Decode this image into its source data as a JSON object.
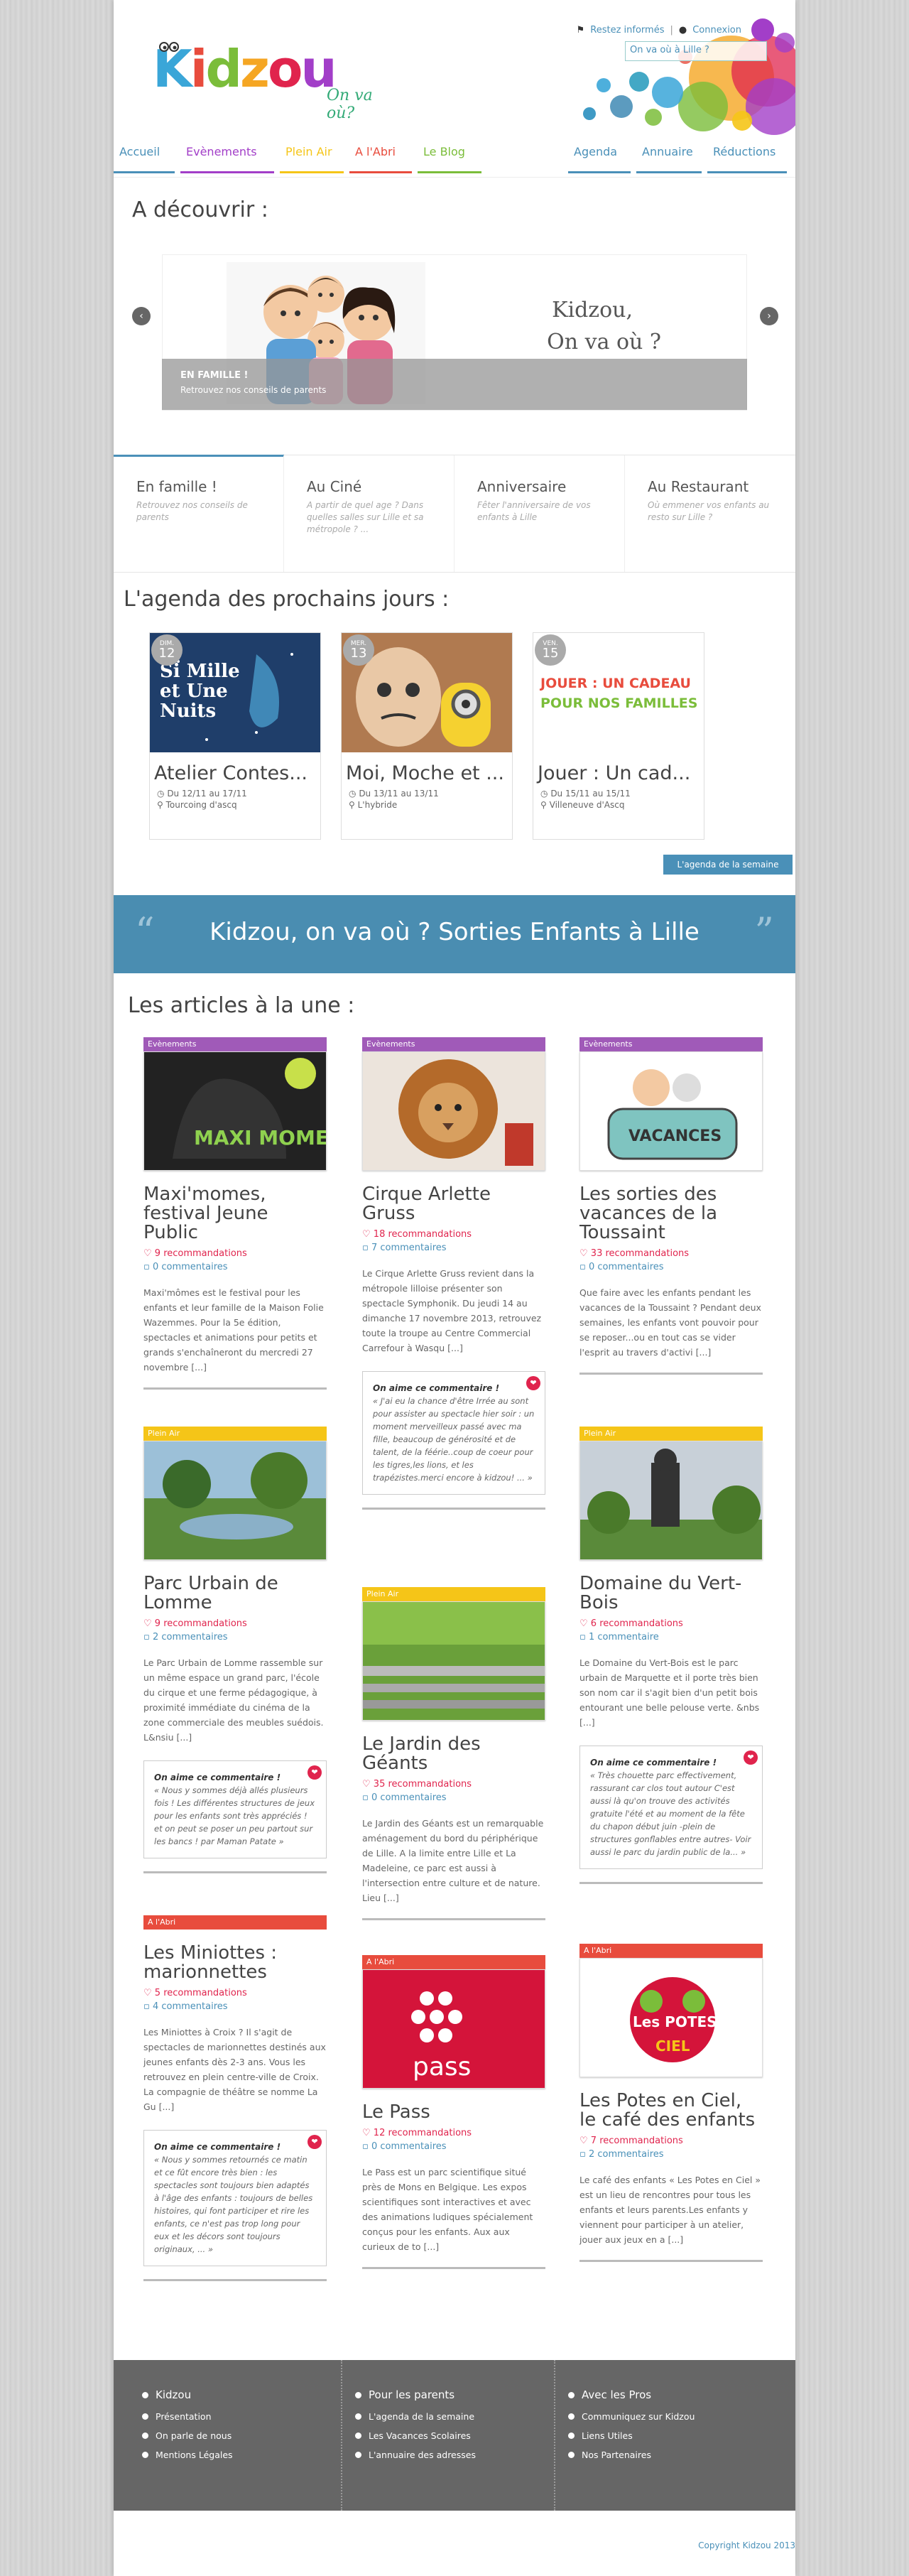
{
  "top": {
    "stay_informed": "Restez informés",
    "login": "Connexion",
    "search_placeholder": "On va où à Lille ?"
  },
  "logo": {
    "word": "Kidzou",
    "tagline": "On va où?"
  },
  "nav": {
    "left": [
      {
        "label": "Accueil",
        "color": "#4a90b8"
      },
      {
        "label": "Evènements",
        "color": "#a23ec8"
      },
      {
        "label": "Plein Air",
        "color": "#f5c518"
      },
      {
        "label": "A l'Abri",
        "color": "#e84c3d"
      },
      {
        "label": "Le Blog",
        "color": "#7bbd3a"
      }
    ],
    "right": [
      "Agenda",
      "Annuaire",
      "Réductions"
    ]
  },
  "discover": {
    "title": "A découvrir :",
    "slide_title_1": "Kidzou,",
    "slide_title_2": "On va où ?",
    "caption_title": "EN FAMILLE !",
    "caption_text": "Retrouvez nos conseils de parents"
  },
  "tabs": [
    {
      "title": "En famille !",
      "text": "Retrouvez nos conseils de parents"
    },
    {
      "title": "Au Ciné",
      "text": "A partir de quel age ? Dans quelles salles sur Lille et sa métropole ? ..."
    },
    {
      "title": "Anniversaire",
      "text": "Fêter l'anniversaire de vos enfants à Lille"
    },
    {
      "title": "Au Restaurant",
      "text": "Où emmener vos enfants au resto sur Lille ?"
    }
  ],
  "agenda": {
    "title": "L'agenda des prochains jours :",
    "cards": [
      {
        "day": "DIM.",
        "num": "12",
        "title": "Atelier Contes...",
        "dates": "Du 12/11 au 17/11",
        "place": "Tourcoing d'ascq"
      },
      {
        "day": "MER.",
        "num": "13",
        "title": "Moi, Moche et ...",
        "dates": "Du 13/11 au 13/11",
        "place": "L'hybride"
      },
      {
        "day": "VEN.",
        "num": "15",
        "title": "Jouer : Un cad...",
        "dates": "Du 15/11 au 15/11",
        "place": "Villeneuve d'Ascq"
      }
    ],
    "week_button": "L'agenda de la semaine",
    "card1_img_text": "Si Mille et Une Nuits",
    "card3_img_text_1": "JOUER : UN CADEAU",
    "card3_img_text_2": "POUR NOS FAMILLES"
  },
  "banner": {
    "text": "Kidzou, on va où ? Sorties Enfants à Lille"
  },
  "articles": {
    "title": "Les articles à la une :",
    "quote_header": "On aime ce commentaire !",
    "items": [
      {
        "cat": "Evènements",
        "title": "Maxi'momes, festival Jeune Public",
        "rec": "9  recommandations",
        "com": "0 commentaires",
        "desc": "Maxi'mômes est le festival pour les enfants et leur famille de la Maison Folie Wazemmes. Pour la 5e édition, spectacles et animations pour petits et grands s'enchaîneront du mercredi 27 novembre [...]",
        "quote": "",
        "pic_text": "MAXI MOMES"
      },
      {
        "cat": "Evènements",
        "title": "Cirque Arlette Gruss",
        "rec": "18  recommandations",
        "com": "7 commentaires",
        "desc": "Le Cirque Arlette Gruss revient dans la métropole lilloise présenter son spectacle Symphonik. Du jeudi 14 au dimanche 17 novembre 2013, retrouvez toute la troupe au Centre Commercial Carrefour à Wasqu [...]",
        "quote": "« J'ai eu la chance d'être Irrée au sont pour assister au spectacle hier soir : un moment merveilleux passé avec ma fille, beaucoup de générosité et de talent, de la féérie..coup de coeur pour les tigres,les lions, et les trapézistes.merci encore à kidzou! ... »"
      },
      {
        "cat": "Evènements",
        "title": "Les sorties des vacances de la Toussaint",
        "rec": "33  recommandations",
        "com": "0 commentaires",
        "desc": "Que faire avec les enfants pendant les vacances de la Toussaint ? Pendant deux semaines, les enfants vont pouvoir pour se reposer...ou en tout cas se vider l'esprit au travers d'activi [...]",
        "quote": "",
        "pic_text": "VACANCES"
      },
      {
        "cat": "Plein Air",
        "title": "Parc Urbain de Lomme",
        "rec": "9  recommandations",
        "com": "2 commentaires",
        "desc": "Le Parc Urbain de Lomme rassemble sur un même espace un grand parc, l'école du cirque et une ferme pédagogique, à proximité immédiate du cinéma de la zone commerciale des meubles suédois. L&nsiu [...]",
        "quote": "« Nous y sommes déjà allés plusieurs fois ! Les différentes structures de jeux pour les enfants sont très appréciés ! et on peut se poser un peu partout sur les bancs ! par Maman Patate »"
      },
      {
        "cat": "Plein Air",
        "title": "Le Jardin des Géants",
        "rec": "35  recommandations",
        "com": "0 commentaires",
        "desc": "Le Jardin des Géants est un remarquable aménagement du bord du périphérique de Lille. A la limite entre Lille et La Madeleine, ce parc est aussi à l'intersection entre culture et de nature. Lieu [...]",
        "quote": ""
      },
      {
        "cat": "Plein Air",
        "title": "Domaine du Vert-Bois",
        "rec": "6  recommandations",
        "com": "1 commentaire",
        "desc": "Le Domaine du Vert-Bois est le parc urbain de Marquette et il porte très bien son nom car il s'agit bien d'un petit bois entourant une belle pelouse verte.     &nbs [...]",
        "quote": "« Très chouette parc effectivement, rassurant car clos tout autour C'est aussi là qu'on trouve des activités gratuite l'été et au moment de la fête du chapon début juin -plein de structures gonflables entre autres- Voir aussi le parc du jardin public de la... »"
      },
      {
        "cat": "A l'Abri",
        "title": "Les Miniottes : marionnettes",
        "rec": "5  recommandations",
        "com": "4 commentaires",
        "desc": "Les Miniottes à Croix ? Il s'agit de spectacles de marionnettes destinés aux jeunes enfants dès 2-3 ans. Vous les retrouvez en plein centre-ville de Croix. La compagnie de théâtre se nomme La Gu [...]",
        "quote": "« Nous y sommes retournés ce matin et ce fût encore très bien : les spectacles sont toujours bien adaptés à l'âge des enfants : toujours de belles histoires, qui font participer et rire les enfants, ce n'est pas trop long pour eux et les décors sont toujours originaux, ... »"
      },
      {
        "cat": "A l'Abri",
        "title": "Le Pass",
        "rec": "12  recommandations",
        "com": "0 commentaires",
        "desc": "Le Pass est un parc scientifique situé près de Mons en Belgique. Les expos scientifiques sont interactives et avec des animations ludiques spécialement conçus pour les enfants. Aux aux curieux de to [...]",
        "quote": "",
        "pic_text": "pass"
      },
      {
        "cat": "A l'Abri",
        "title": "Les Potes en Ciel, le café des enfants",
        "rec": "7  recommandations",
        "com": "2 commentaires",
        "desc": "Le café des enfants « Les Potes en Ciel » est un lieu de rencontres pour tous les enfants et leurs parents.Les enfants y viennent pour participer à un atelier, jouer aux jeux en a [...]",
        "quote": "",
        "pic_text_1": "Les POTES",
        "pic_text_2": "CIEL"
      }
    ]
  },
  "footer": {
    "cols": [
      {
        "head": "Kidzou",
        "items": [
          "Présentation",
          "On parle de nous",
          "Mentions Légales"
        ]
      },
      {
        "head": "Pour les parents",
        "items": [
          "L'agenda de la semaine",
          "Les Vacances Scolaires",
          "L'annuaire des adresses"
        ]
      },
      {
        "head": "Avec les Pros",
        "items": [
          "Communiquez sur Kidzou",
          "Liens Utiles",
          "Nos Partenaires"
        ]
      }
    ],
    "copyright": "Copyright Kidzou 2013"
  },
  "colors": {
    "events": "#a05ab8",
    "outdoor": "#f5c518",
    "indoor": "#e84c3d",
    "link": "#4a90b8",
    "heart": "#e0244d"
  }
}
